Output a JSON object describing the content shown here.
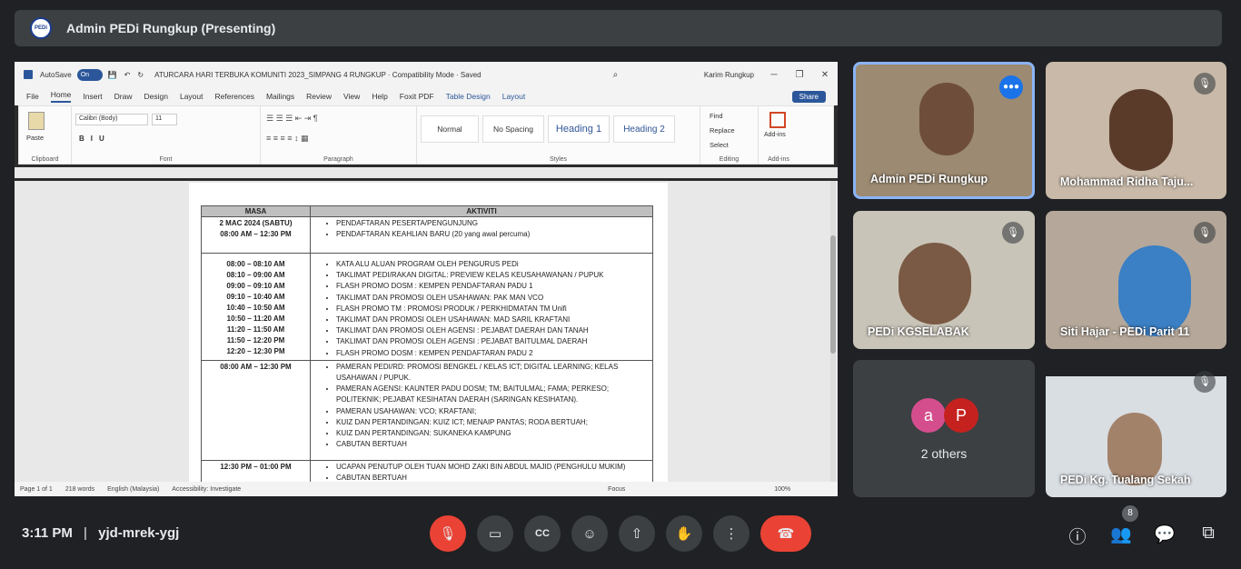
{
  "header": {
    "title": "Admin PEDi Rungkup (Presenting)",
    "logo_text": "PEDi"
  },
  "word": {
    "autosave": "AutoSave",
    "toggle": "On",
    "doc_title": "ATURCARA HARI TERBUKA KOMUNITI 2023_SIMPANG 4 RUNGKUP  ·  Compatibility Mode  ·  Saved",
    "user": "Karim Rungkup",
    "menu": [
      "File",
      "Home",
      "Insert",
      "Draw",
      "Design",
      "Layout",
      "References",
      "Mailings",
      "Review",
      "View",
      "Help",
      "Foxit PDF",
      "Table Design",
      "Layout"
    ],
    "share": "Share",
    "ribbon": {
      "clipboard": "Clipboard",
      "paste": "Paste",
      "font": "Font",
      "font_name": "Calibri (Body)",
      "font_size": "11",
      "paragraph": "Paragraph",
      "styles": "Styles",
      "style_items": [
        "Normal",
        "No Spacing",
        "Heading 1",
        "Heading 2"
      ],
      "editing": "Editing",
      "find": "Find",
      "replace": "Replace",
      "select": "Select",
      "addins": "Add-ins"
    },
    "table": {
      "headers": [
        "MASA",
        "AKTIVITI"
      ],
      "rows": [
        {
          "masa": [
            "2 MAC 2024 (SABTU)",
            "08:00 AM – 12:30 PM"
          ],
          "items": [
            "PENDAFTARAN PESERTA/PENGUNJUNG",
            "PENDAFTARAN KEAHLIAN BARU (20 yang awal percuma)"
          ]
        },
        {
          "masa": [
            "08:00 – 08:10 AM",
            "08:10 – 09:00 AM",
            "09:00 – 09:10 AM",
            "09:10 – 10:40 AM",
            "10:40 – 10:50 AM",
            "10:50 – 11:20 AM",
            "11:20 – 11:50 AM",
            "11:50 – 12:20 PM",
            "12:20 – 12:30 PM"
          ],
          "items": [
            "KATA ALU ALUAN PROGRAM OLEH PENGURUS PEDi",
            "TAKLIMAT PEDI/RAKAN DIGITAL: PREVIEW KELAS KEUSAHAWANAN / PUPUK",
            "FLASH PROMO DOSM : KEMPEN PENDAFTARAN PADU 1",
            "TAKLIMAT DAN PROMOSI OLEH USAHAWAN: PAK MAN VCO",
            "FLASH PROMO TM : PROMOSI PRODUK / PERKHIDMATAN TM Unifi",
            "TAKLIMAT DAN PROMOSI OLEH USAHAWAN: MAD SARIL KRAFTANI",
            "TAKLIMAT DAN PROMOSI OLEH AGENSI : PEJABAT DAERAH DAN TANAH",
            "TAKLIMAT DAN PROMOSI OLEH AGENSI : PEJABAT BAITULMAL DAERAH",
            "FLASH PROMO DOSM : KEMPEN PENDAFTARAN PADU 2"
          ]
        },
        {
          "masa": [
            "08:00 AM – 12:30 PM"
          ],
          "items": [
            "PAMERAN PEDI/RD: PROMOSI BENGKEL / KELAS ICT; DIGITAL LEARNING; KELAS USAHAWAN / PUPUK.",
            "PAMERAN AGENSI: KAUNTER PADU DOSM; TM; BAITULMAL; FAMA; PERKESO; POLITEKNIK; PEJABAT KESIHATAN DAERAH (SARINGAN KESIHATAN).",
            "PAMERAN USAHAWAN: VCO; KRAFTANI;",
            "KUIZ DAN PERTANDINGAN: KUIZ ICT; MENAIP PANTAS; RODA BERTUAH;",
            "KUIZ DAN PERTANDINGAN: SUKANEKA KAMPUNG",
            "CABUTAN BERTUAH"
          ]
        },
        {
          "masa": [
            "12:30 PM – 01:00 PM"
          ],
          "items": [
            "UCAPAN PENUTUP OLEH TUAN MOHD ZAKI BIN ABDUL MAJID (PENGHULU MUKIM)",
            "CABUTAN BERTUAH"
          ]
        }
      ]
    },
    "status": {
      "page": "Page 1 of 1",
      "words": "218 words",
      "lang": "English (Malaysia)",
      "access": "Accessibility: Investigate",
      "focus": "Focus",
      "zoom": "100%"
    }
  },
  "participants": [
    {
      "name": "Admin PEDi Rungkup"
    },
    {
      "name": "Mohammad Ridha Taju..."
    },
    {
      "name": "PEDi KGSELABAK"
    },
    {
      "name": "Siti Hajar - PEDi Parit 11"
    },
    {
      "name": "2 others",
      "avatars": [
        "a",
        "P"
      ]
    },
    {
      "name": "PEDi Kg. Tualang Sekah"
    }
  ],
  "bottom": {
    "time": "3:11 PM",
    "separator": "|",
    "code": "yjd-mrek-ygj",
    "people_count": "8"
  },
  "colors": {
    "accent": "#1a73e8",
    "end_call": "#ea4335",
    "mic_off": "#ea4335"
  }
}
